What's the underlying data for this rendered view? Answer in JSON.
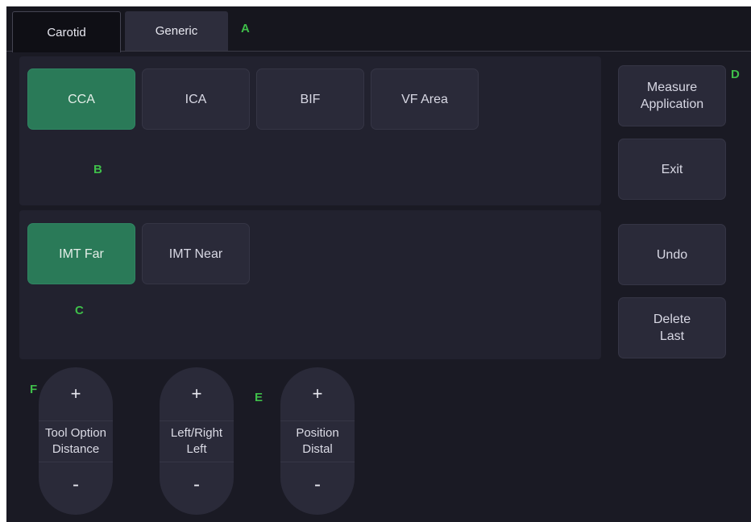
{
  "tabs": [
    {
      "label": "Carotid",
      "active": true
    },
    {
      "label": "Generic",
      "active": false
    }
  ],
  "callouts": {
    "a": "A",
    "b": "B",
    "c": "C",
    "d": "D",
    "e": "E",
    "f": "F"
  },
  "vessel_buttons": [
    {
      "label": "CCA",
      "selected": true
    },
    {
      "label": "ICA",
      "selected": false
    },
    {
      "label": "BIF",
      "selected": false
    },
    {
      "label": "VF Area",
      "selected": false
    }
  ],
  "imt_buttons": [
    {
      "label": "IMT Far",
      "selected": true
    },
    {
      "label": "IMT Near",
      "selected": false
    }
  ],
  "side_buttons": {
    "measure_line1": "Measure",
    "measure_line2": "Application",
    "exit": "Exit",
    "undo": "Undo",
    "delete_line1": "Delete",
    "delete_line2": "Last"
  },
  "knobs": [
    {
      "plus": "+",
      "line1": "Tool Option",
      "line2": "Distance",
      "minus": "-"
    },
    {
      "plus": "+",
      "line1": "Left/Right",
      "line2": "Left",
      "minus": "-"
    },
    {
      "plus": "+",
      "line1": "Position",
      "line2": "Distal",
      "minus": "-"
    }
  ],
  "colors": {
    "selected": "#2a7a58",
    "button": "#2a2a39",
    "callout": "#3fbf4a",
    "background": "#1a1a24"
  }
}
